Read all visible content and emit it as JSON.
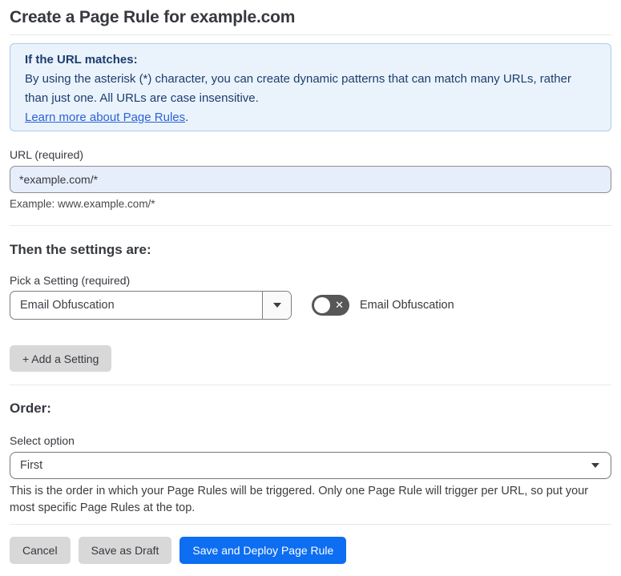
{
  "page": {
    "title": "Create a Page Rule for example.com"
  },
  "info_box": {
    "heading": "If the URL matches:",
    "body": "By using the asterisk (*) character, you can create dynamic patterns that can match many URLs, rather than just one. All URLs are case insensitive.",
    "link_label": "Learn more about Page Rules",
    "link_suffix": "."
  },
  "url_field": {
    "label": "URL (required)",
    "value": "*example.com/*",
    "helper": "Example: www.example.com/*"
  },
  "settings_section": {
    "heading": "Then the settings are:",
    "setting_label": "Pick a Setting (required)",
    "setting_value": "Email Obfuscation",
    "toggle_label": "Email Obfuscation",
    "toggle_state": "off",
    "add_setting_label": "+ Add a Setting"
  },
  "order_section": {
    "heading": "Order:",
    "select_label": "Select option",
    "select_value": "First",
    "helper": "This is the order in which your Page Rules will be triggered. Only one Page Rule will trigger per URL, so put your most specific Page Rules at the top."
  },
  "footer": {
    "cancel_label": "Cancel",
    "save_draft_label": "Save as Draft",
    "save_deploy_label": "Save and Deploy Page Rule"
  },
  "icons": {
    "toggle_off_glyph": "✕"
  },
  "colors": {
    "accent_blue": "#0d6ef2",
    "link_blue": "#2b62d6",
    "info_background": "#eaf3fc",
    "info_border": "#aacbec",
    "info_text": "#1d3d6e",
    "url_input_background": "#e7eefb",
    "gray_button_background": "#d8d8d8",
    "toggle_background": "#575757",
    "text_dark": "#36393f"
  }
}
